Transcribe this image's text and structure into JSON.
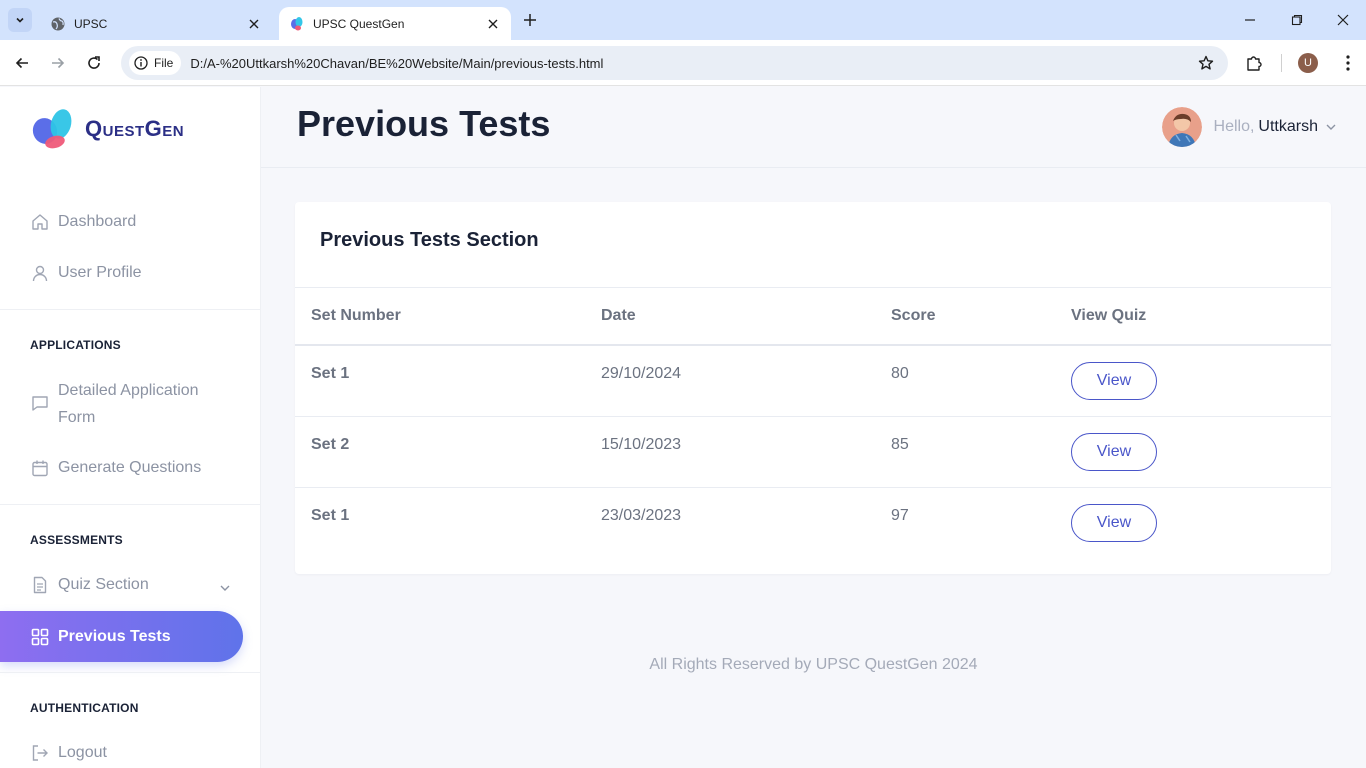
{
  "browser": {
    "tabs": [
      {
        "title": "UPSC",
        "active": false
      },
      {
        "title": "UPSC QuestGen",
        "active": true
      }
    ],
    "site_chip": "File",
    "url": "D:/A-%20Uttkarsh%20Chavan/BE%20Website/Main/previous-tests.html",
    "profile_initial": "U"
  },
  "sidebar": {
    "logo_text": "QuestGen",
    "items_top": [
      {
        "label": "Dashboard",
        "icon": "home-icon"
      },
      {
        "label": "User Profile",
        "icon": "user-icon"
      }
    ],
    "sections": {
      "applications": "APPLICATIONS",
      "assessments": "ASSESSMENTS",
      "authentication": "AUTHENTICATION"
    },
    "applications_items": [
      {
        "label_line1": "Detailed Application",
        "label_line2": "Form",
        "icon": "chat-icon"
      },
      {
        "label": "Generate Questions",
        "icon": "calendar-icon"
      }
    ],
    "assessments_items": [
      {
        "label": "Quiz Section",
        "icon": "document-icon"
      },
      {
        "label": "Previous Tests",
        "icon": "grid-icon",
        "active": true
      }
    ],
    "authentication_items": [
      {
        "label": "Logout",
        "icon": "logout-icon"
      }
    ]
  },
  "header": {
    "title": "Previous Tests",
    "hello": "Hello,",
    "username": "Uttkarsh"
  },
  "card": {
    "title": "Previous Tests Section",
    "columns": [
      "Set Number",
      "Date",
      "Score",
      "View Quiz"
    ],
    "rows": [
      {
        "set": "Set 1",
        "date": "29/10/2024",
        "score": "80",
        "action": "View"
      },
      {
        "set": "Set 2",
        "date": "15/10/2023",
        "score": "85",
        "action": "View"
      },
      {
        "set": "Set 1",
        "date": "23/03/2023",
        "score": "97",
        "action": "View"
      }
    ]
  },
  "footer": "All Rights Reserved by UPSC QuestGen 2024",
  "colors": {
    "accent": "#5f73ea",
    "accent_gradient_start": "#8e6ef0",
    "button_outline": "#4a56c9",
    "title_text": "#1a2236",
    "muted_text": "#8c93a3"
  }
}
